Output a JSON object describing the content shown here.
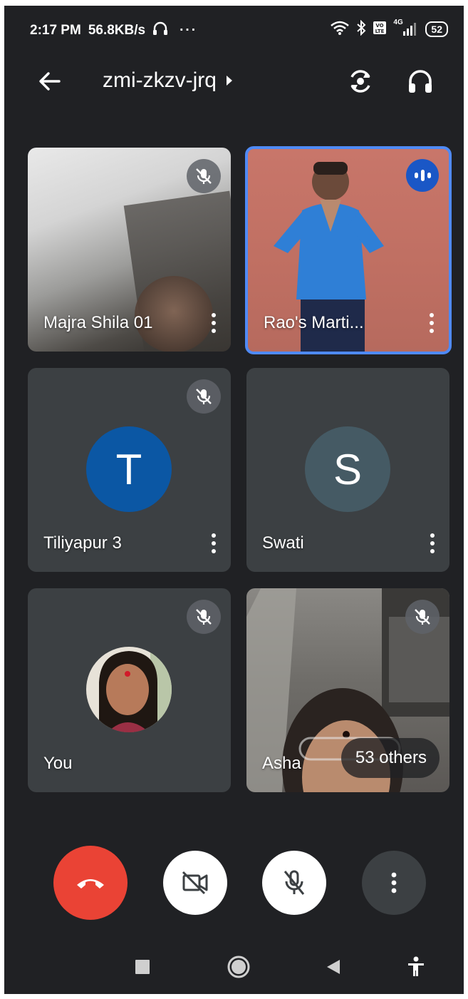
{
  "status_bar": {
    "time": "2:17 PM",
    "speed": "56.8KB/s",
    "more": "···",
    "icons": [
      "headset-icon",
      "wifi-icon",
      "bluetooth-icon",
      "volte-icon",
      "signal-icon"
    ],
    "network": "4G",
    "battery": "52"
  },
  "header": {
    "meeting_code": "zmi-zkzv-jrq",
    "icons": [
      "back-arrow-icon",
      "caret-right-icon",
      "switch-camera-icon",
      "headphones-icon"
    ]
  },
  "participants": [
    {
      "name": "Majra Shila 01",
      "type": "video",
      "muted": true
    },
    {
      "name": "Rao's Marti...",
      "type": "video",
      "speaking": true
    },
    {
      "name": "Tiliyapur 3",
      "type": "avatar",
      "initial": "T",
      "avatar_color": "#0b57a4",
      "muted": true
    },
    {
      "name": "Swati",
      "type": "avatar",
      "initial": "S",
      "avatar_color": "#455a64"
    },
    {
      "name": "You",
      "type": "photo",
      "muted": true
    },
    {
      "name": "Asha",
      "type": "video",
      "muted": true
    }
  ],
  "others_pill": {
    "label": "53 others"
  },
  "controls": {
    "end_call_color": "#ea4335",
    "icons": [
      "end-call-icon",
      "camera-off-icon",
      "mic-off-icon",
      "more-vert-icon"
    ]
  },
  "nav_bar": {
    "icons": [
      "recents-icon",
      "home-icon",
      "back-icon",
      "accessibility-icon"
    ]
  }
}
